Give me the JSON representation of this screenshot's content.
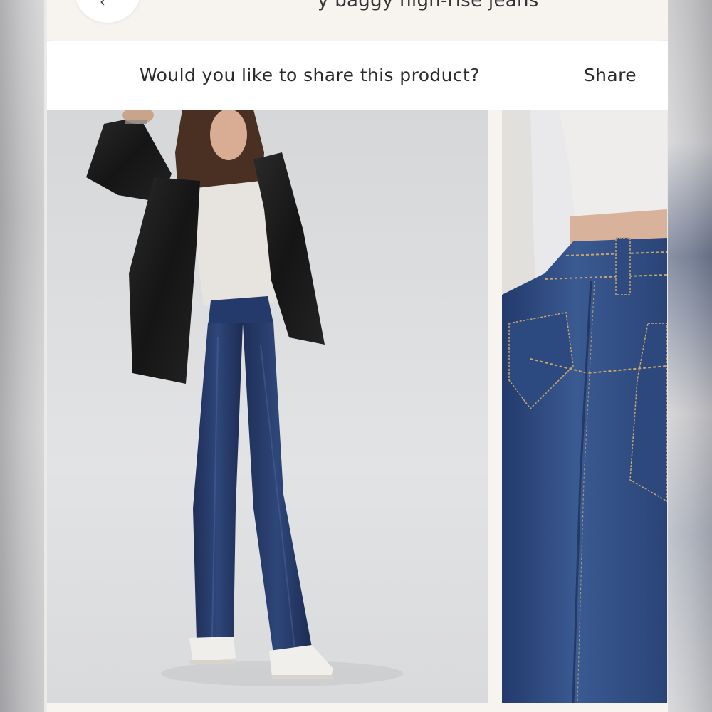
{
  "header": {
    "back_icon": "chevron-left-icon",
    "cut_title": "y baggy high-rise jeans"
  },
  "share_bar": {
    "question": "Would you like to share this product?",
    "share_label": "Share"
  },
  "gallery": {
    "images": [
      {
        "name": "model-full-length-photo"
      },
      {
        "name": "jeans-back-pocket-detail-photo"
      }
    ]
  },
  "colors": {
    "page_background": "#f6f4f1",
    "card_background": "#ffffff",
    "text": "#2b2b2b",
    "denim": "#2a3f6e"
  }
}
